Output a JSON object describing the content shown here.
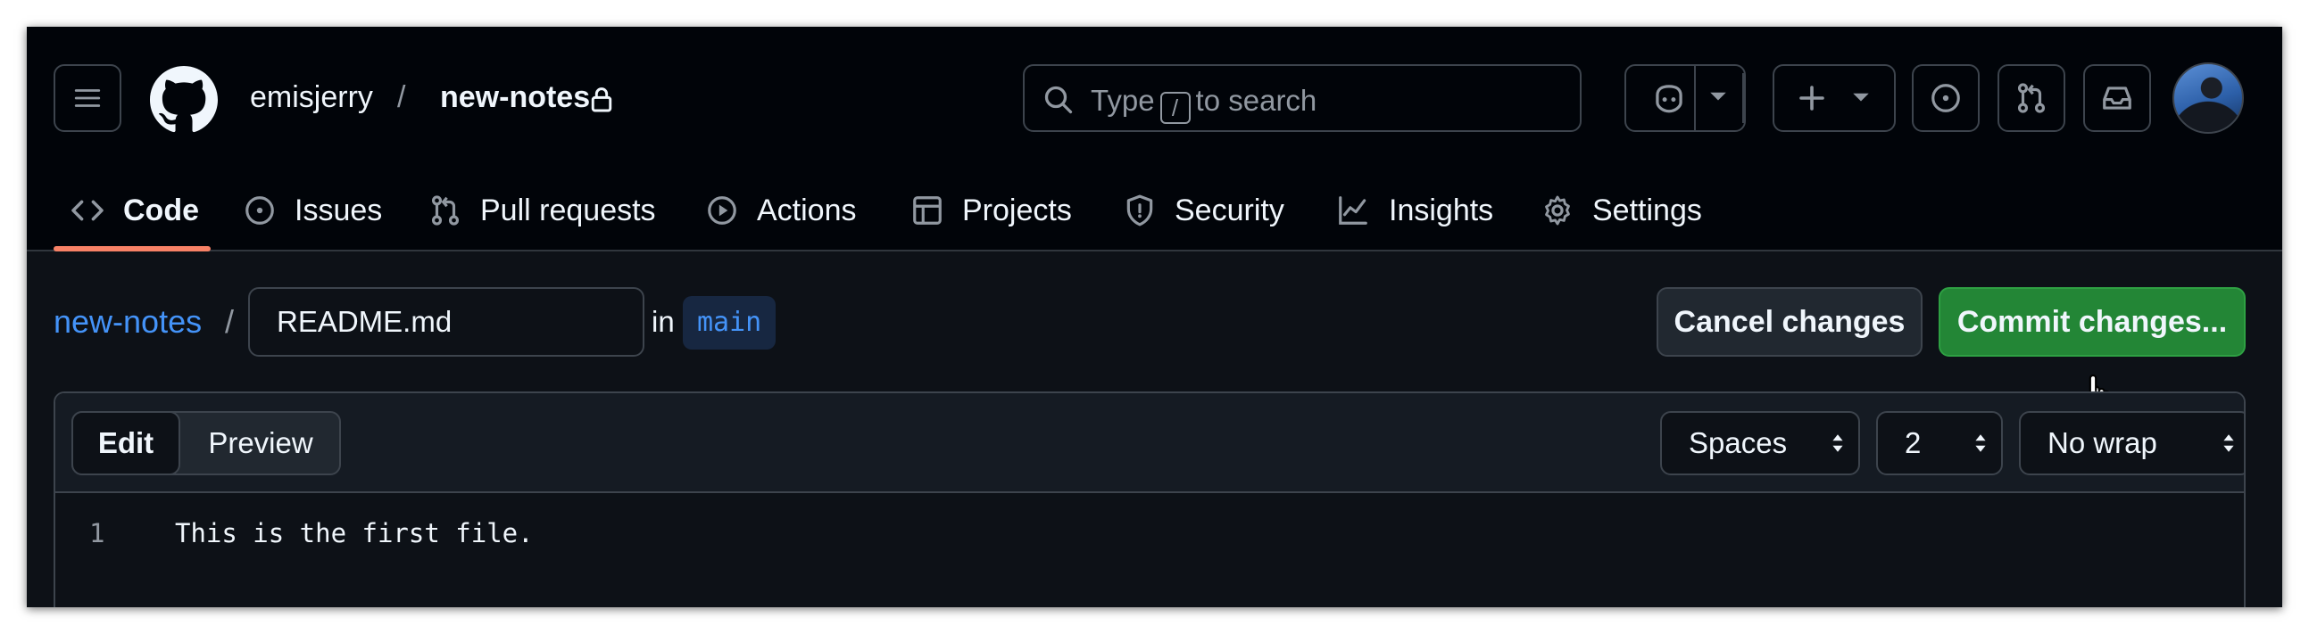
{
  "header": {
    "owner": "emisjerry",
    "separator": "/",
    "repo": "new-notes",
    "search": {
      "prefix": "Type",
      "key": "/",
      "suffix": "to search"
    }
  },
  "tabs": [
    {
      "label": "Code",
      "icon": "code-icon",
      "active": true
    },
    {
      "label": "Issues",
      "icon": "issue-opened-icon"
    },
    {
      "label": "Pull requests",
      "icon": "git-pull-request-icon"
    },
    {
      "label": "Actions",
      "icon": "play-icon"
    },
    {
      "label": "Projects",
      "icon": "table-icon"
    },
    {
      "label": "Security",
      "icon": "shield-icon"
    },
    {
      "label": "Insights",
      "icon": "graph-icon"
    },
    {
      "label": "Settings",
      "icon": "gear-icon"
    }
  ],
  "editor_bar": {
    "repo_link": "new-notes",
    "separator": "/",
    "filename": "README.md",
    "in_label": "in",
    "branch": "main",
    "cancel_label": "Cancel changes",
    "commit_label": "Commit changes..."
  },
  "editor": {
    "mode_tabs": {
      "edit": "Edit",
      "preview": "Preview"
    },
    "indent_mode": "Spaces",
    "indent_size": "2",
    "wrap_mode": "No wrap",
    "lines": [
      {
        "number": "1",
        "text": "This is the first file."
      }
    ]
  },
  "colors": {
    "accent": "#4493f8",
    "commit_green": "#238636",
    "tab_underline": "#f78166",
    "background": "#0d1117"
  }
}
